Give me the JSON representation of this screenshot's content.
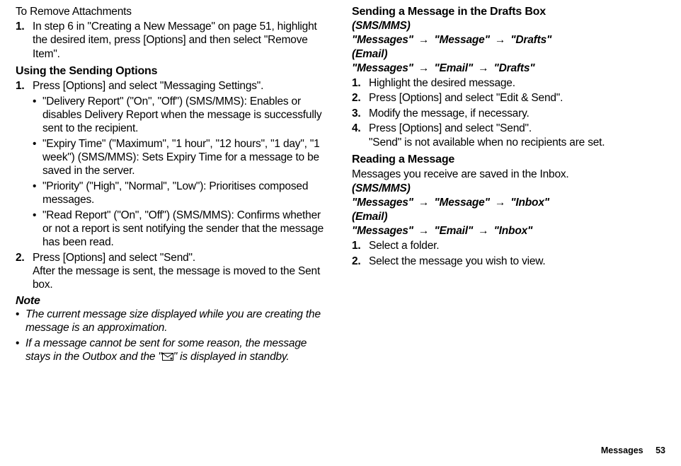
{
  "left": {
    "remove_heading": "To Remove Attachments",
    "remove_step1": "In step 6 in \"Creating a New Message\" on page 51, highlight the desired item, press [Options] and then select \"Remove Item\".",
    "sending_options_heading": "Using the Sending Options",
    "step1": "Press [Options] and select \"Messaging Settings\".",
    "bullet1": "\"Delivery Report\" (\"On\", \"Off\") (SMS/MMS): Enables or disables Delivery Report when the message is successfully sent to the recipient.",
    "bullet2": "\"Expiry Time\" (\"Maximum\", \"1 hour\", \"12 hours\", \"1 day\", \"1 week\") (SMS/MMS): Sets Expiry Time for a message to be saved in the server.",
    "bullet3": "\"Priority\" (\"High\", \"Normal\", \"Low\"): Prioritises composed messages.",
    "bullet4": "\"Read Report\" (\"On\", \"Off\") (SMS/MMS): Confirms whether or not a report is sent notifying the sender that the message has been read.",
    "step2": "Press [Options] and select \"Send\".",
    "step2_sub": "After the message is sent, the message is moved to the Sent box.",
    "note_heading": "Note",
    "note1": "The current message size displayed while you are creating the message is an approximation.",
    "note2_a": "If a message cannot be sent for some reason, the message stays in the Outbox and the \"",
    "note2_b": "\" is displayed in standby."
  },
  "right": {
    "drafts_heading": "Sending a Message in the Drafts Box",
    "sms_label": "(SMS/MMS)",
    "path_messages": "\"Messages\"",
    "path_message": "\"Message\"",
    "path_drafts": "\"Drafts\"",
    "email_label": "(Email)",
    "path_email": "\"Email\"",
    "d_step1": "Highlight the desired message.",
    "d_step2": "Press [Options] and select \"Edit & Send\".",
    "d_step3": "Modify the message, if necessary.",
    "d_step4": "Press [Options] and select \"Send\".",
    "d_step4_sub": "\"Send\" is not available when no recipients are set.",
    "reading_heading": "Reading a Message",
    "reading_desc": "Messages you receive are saved in the Inbox.",
    "path_inbox": "\"Inbox\"",
    "r_step1": "Select a folder.",
    "r_step2": "Select the message you wish to view."
  },
  "footer": {
    "chapter": "Messages",
    "page": "53"
  }
}
